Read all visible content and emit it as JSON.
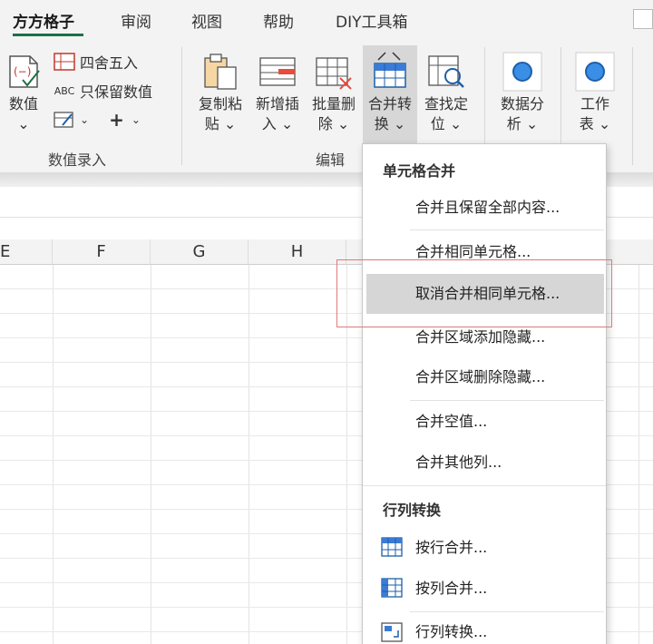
{
  "tabs": [
    {
      "label": "方方格子",
      "active": true
    },
    {
      "label": "审阅",
      "active": false
    },
    {
      "label": "视图",
      "active": false
    },
    {
      "label": "帮助",
      "active": false
    },
    {
      "label": "DIY工具箱",
      "active": false
    }
  ],
  "ribbon": {
    "value_entry": {
      "big_button_label1": "数值",
      "big_button_label2": "⌄",
      "round_label": "四舍五入",
      "keep_value_label": "只保留数值",
      "keep_value_prefix": "ABC",
      "group_label": "数值录入"
    },
    "edit": {
      "copy_paste": [
        "复制粘",
        "贴 ⌄"
      ],
      "insert_new": [
        "新增插",
        "入 ⌄"
      ],
      "batch_delete": [
        "批量删",
        "除 ⌄"
      ],
      "merge_convert": [
        "合并转",
        "换 ⌄"
      ],
      "find_locate": [
        "查找定",
        "位 ⌄"
      ],
      "group_label": "编辑"
    },
    "data_analysis": [
      "数据分",
      "析 ⌄"
    ],
    "worksheet": [
      "工作",
      "表 ⌄"
    ]
  },
  "columns": [
    "E",
    "F",
    "G",
    "H"
  ],
  "menu": {
    "section1": "单元格合并",
    "items1": [
      "合并且保留全部内容...",
      "合并相同单元格...",
      "取消合并相同单元格...",
      "合并区域添加隐藏...",
      "合并区域删除隐藏...",
      "合并空值...",
      "合并其他列..."
    ],
    "section2": "行列转换",
    "items2": [
      "按行合并...",
      "按列合并...",
      "行列转换..."
    ],
    "highlighted_item": "取消合并相同单元格..."
  },
  "colors": {
    "accent": "#1e7145",
    "highlight": "#d6d6d6",
    "annotation": "#e07a7a"
  }
}
